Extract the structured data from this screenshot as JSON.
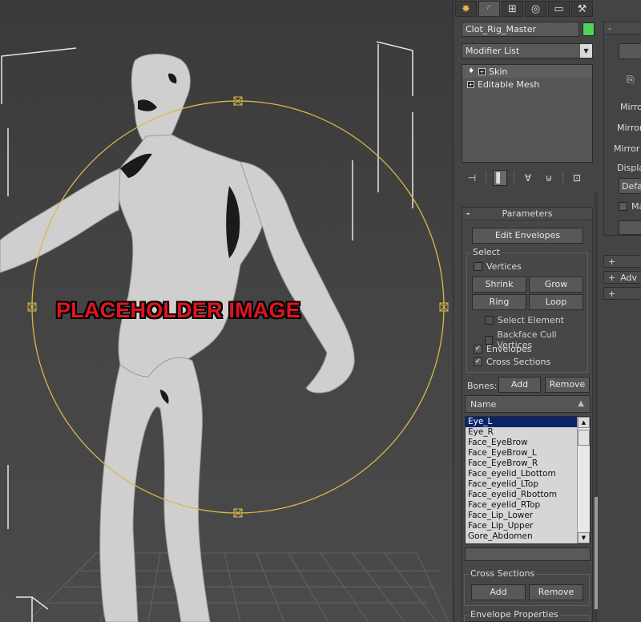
{
  "viewport": {
    "placeholder_text": "PLACEHOLDER IMAGE"
  },
  "tabs": [
    {
      "name": "create",
      "icon": "sun-star-icon"
    },
    {
      "name": "modify",
      "icon": "modify-arc-icon"
    },
    {
      "name": "hierarchy",
      "icon": "hierarchy-icon"
    },
    {
      "name": "motion",
      "icon": "motion-circle-icon"
    },
    {
      "name": "display",
      "icon": "display-monitor-icon"
    },
    {
      "name": "utilities",
      "icon": "hammer-icon"
    }
  ],
  "object": {
    "name": "Clot_Rig_Master",
    "color": "#4fd35a"
  },
  "modifier_list": {
    "value": "Modifier List"
  },
  "stack": {
    "items": [
      {
        "label": "Skin"
      },
      {
        "label": "Editable Mesh"
      }
    ]
  },
  "parameters": {
    "title": "Parameters",
    "minus": "-",
    "edit_envelopes": "Edit Envelopes",
    "select_group": "Select",
    "vertices": "Vertices",
    "shrink": "Shrink",
    "grow": "Grow",
    "ring": "Ring",
    "loop": "Loop",
    "select_element": "Select Element",
    "backface_cull": "Backface Cull Vertices",
    "envelopes": "Envelopes",
    "cross_sections": "Cross Sections",
    "bones_label": "Bones:",
    "add": "Add",
    "remove": "Remove",
    "name_header": "Name",
    "cross_sections_group": "Cross Sections",
    "cs_add": "Add",
    "cs_remove": "Remove",
    "envelope_properties": "Envelope Properties"
  },
  "bones": [
    "Eye_L",
    "Eye_R",
    "Face_EyeBrow",
    "Face_EyeBrow_L",
    "Face_EyeBrow_R",
    "Face_eyelid_Lbottom",
    "Face_eyelid_LTop",
    "Face_eyelid_Rbottom",
    "Face_eyelid_RTop",
    "Face_Lip_Lower",
    "Face_Lip_Upper",
    "Gore_Abdomen"
  ],
  "right_column": {
    "minus": "-",
    "mirror1": "Mirror",
    "mirror2": "Mirror",
    "mirror3": "Mirror T",
    "display": "Display",
    "default": "Defau",
    "ma": "Ma",
    "plus": "+",
    "adv": "Adv"
  }
}
